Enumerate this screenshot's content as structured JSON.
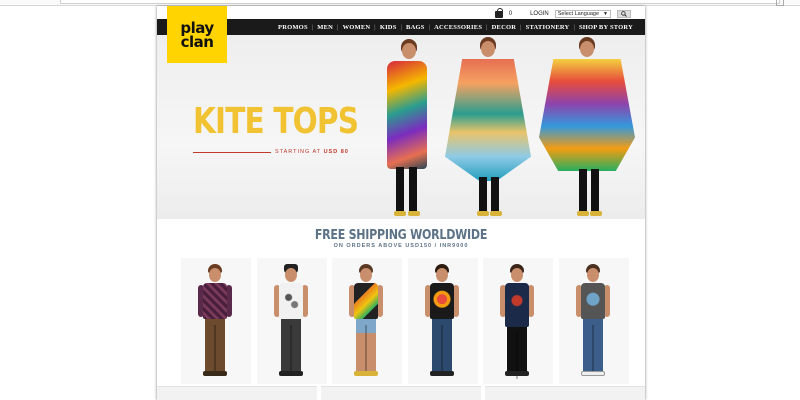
{
  "header": {
    "logo_line1": "play",
    "logo_line2": "clan",
    "cart_count": "0",
    "login_label": "LOGIN",
    "language_select": "Select Language",
    "language_arrow": "▼"
  },
  "nav": {
    "items": [
      {
        "label": "PROMOS"
      },
      {
        "label": "MEN"
      },
      {
        "label": "WOMEN"
      },
      {
        "label": "KIDS"
      },
      {
        "label": "BAGS"
      },
      {
        "label": "ACCESSORIES"
      },
      {
        "label": "DECOR"
      },
      {
        "label": "STATIONERY"
      },
      {
        "label": "SHOP BY STORY"
      }
    ]
  },
  "hero": {
    "title": "KITE TOPS",
    "subtitle_prefix": "STARTING AT ",
    "subtitle_price": "USD 80"
  },
  "shipping": {
    "headline": "FREE SHIPPING WORLDWIDE",
    "subline": "ON ORDERS ABOVE USD150 / INR9000"
  },
  "colors": {
    "brand_yellow": "#ffd400",
    "hero_title": "#f1c232",
    "accent_red": "#c0392b",
    "shipping_text": "#5b7287",
    "nav_bg": "#1a1a1a"
  },
  "icons": {
    "cart": "shopping-bag-icon",
    "dropdown": "chevron-down-icon",
    "search": "search-icon"
  }
}
